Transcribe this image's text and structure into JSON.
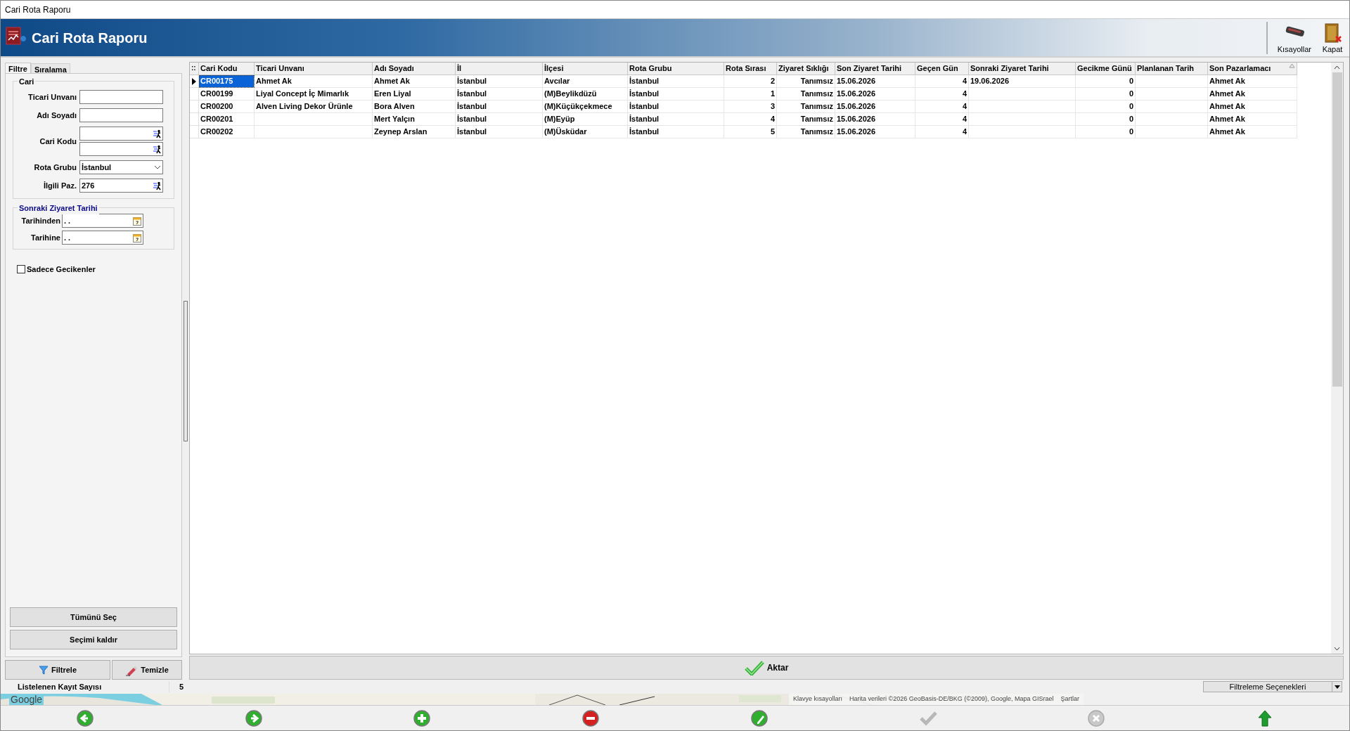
{
  "window": {
    "title": "Cari Rota Raporu"
  },
  "header": {
    "title": "Cari Rota Raporu"
  },
  "toolbar": [
    {
      "label": "Kısayollar",
      "kind": "keyboard"
    },
    {
      "label": "Kapat",
      "kind": "close"
    }
  ],
  "filter_panel": {
    "tabs": [
      {
        "label": "Filtre",
        "selected": true
      },
      {
        "label": "Sıralama",
        "selected": false
      }
    ],
    "cari_group": {
      "title": "Cari",
      "fields": [
        {
          "label": "Ticari Unvanı",
          "kind": "text"
        },
        {
          "label": "Adı Soyadı",
          "kind": "text"
        },
        {
          "label": "Cari Kodu",
          "kind": "lookup_range"
        },
        {
          "label": "Rota Grubu",
          "kind": "combo",
          "value": "İstanbul"
        },
        {
          "label": "İlgili Paz.",
          "kind": "lookup",
          "value": "276"
        }
      ]
    },
    "date_group": {
      "title": "Sonraki Ziyaret Tarihi",
      "fields": [
        {
          "label": "Tarihinden",
          "value": ". ."
        },
        {
          "label": "Tarihine",
          "value": ". ."
        }
      ]
    },
    "checkbox": {
      "label": "Sadece Gecikenler",
      "checked": false
    },
    "select_buttons": [
      "Tümünü Seç",
      "Seçimi kaldır"
    ],
    "action_buttons": [
      {
        "label": "Filtrele",
        "kind": "filter"
      },
      {
        "label": "Temizle",
        "kind": "clear"
      }
    ]
  },
  "grid": {
    "indicator": "::",
    "columns": [
      {
        "title": "Cari Kodu",
        "kind": "text",
        "sorted": false
      },
      {
        "title": "Ticari Unvanı",
        "kind": "text",
        "sorted": false
      },
      {
        "title": "Adı Soyadı",
        "kind": "text",
        "sorted": false
      },
      {
        "title": "İl",
        "kind": "text",
        "sorted": false
      },
      {
        "title": "İlçesi",
        "kind": "text",
        "sorted": false
      },
      {
        "title": "Rota Grubu",
        "kind": "text",
        "sorted": false
      },
      {
        "title": "Rota Sırası",
        "kind": "number",
        "sorted": false
      },
      {
        "title": "Ziyaret Sıklığı",
        "kind": "number",
        "sorted": false
      },
      {
        "title": "Son Ziyaret Tarihi",
        "kind": "text",
        "sorted": false
      },
      {
        "title": "Geçen Gün",
        "kind": "number",
        "sorted": false
      },
      {
        "title": "Sonraki Ziyaret Tarihi",
        "kind": "text",
        "sorted": false
      },
      {
        "title": "Gecikme Günü",
        "kind": "number",
        "sorted": false
      },
      {
        "title": "Planlanan Tarih",
        "kind": "text",
        "sorted": false
      },
      {
        "title": "Son Pazarlamacı",
        "kind": "text",
        "sorted": true
      }
    ],
    "rows": [
      {
        "selected": true,
        "cells": [
          "CR00175",
          "Ahmet Ak",
          "Ahmet  Ak",
          "İstanbul",
          "Avcılar",
          "İstanbul",
          "2",
          "Tanımsız",
          "15.06.2026",
          "4",
          "19.06.2026",
          "0",
          "",
          "Ahmet Ak"
        ]
      },
      {
        "selected": false,
        "cells": [
          "CR00199",
          "Liyal Concept İç Mimarlık",
          "Eren  Liyal",
          "İstanbul",
          "(M)Beylikdüzü",
          "İstanbul",
          "1",
          "Tanımsız",
          "15.06.2026",
          "4",
          "",
          "0",
          "",
          "Ahmet Ak"
        ]
      },
      {
        "selected": false,
        "cells": [
          "CR00200",
          "Alven Living Dekor Ürünle",
          "Bora Alven",
          "İstanbul",
          "(M)Küçükçekmece",
          "İstanbul",
          "3",
          "Tanımsız",
          "15.06.2026",
          "4",
          "",
          "0",
          "",
          "Ahmet Ak"
        ]
      },
      {
        "selected": false,
        "cells": [
          "CR00201",
          "",
          "Mert Yalçın",
          "İstanbul",
          "(M)Eyüp",
          "İstanbul",
          "4",
          "Tanımsız",
          "15.06.2026",
          "4",
          "",
          "0",
          "",
          "Ahmet Ak"
        ]
      },
      {
        "selected": false,
        "cells": [
          "CR00202",
          "",
          "Zeynep Arslan",
          "İstanbul",
          "(M)Üsküdar",
          "İstanbul",
          "5",
          "Tanımsız",
          "15.06.2026",
          "4",
          "",
          "0",
          "",
          "Ahmet Ak"
        ]
      }
    ]
  },
  "export_button": {
    "label": "Aktar"
  },
  "status": {
    "label": "Listelenen Kayıt Sayısı",
    "value": "5"
  },
  "filter_options": {
    "label": "Filtreleme Seçenekleri"
  },
  "map": {
    "kind": "picture",
    "logo": "Google",
    "shortcuts": "Klavye kısayolları",
    "attribution": "Harita verileri ©2026 GeoBasis-DE/BKG (©2009), Google, Mapa GISrael",
    "terms": "Şartlar"
  },
  "nav_buttons": [
    {
      "kind": "back",
      "disabled": false
    },
    {
      "kind": "forward",
      "disabled": false
    },
    {
      "kind": "add",
      "disabled": false
    },
    {
      "kind": "delete",
      "disabled": false
    },
    {
      "kind": "edit",
      "disabled": false
    },
    {
      "kind": "confirm",
      "disabled": true
    },
    {
      "kind": "cancel",
      "disabled": true
    },
    {
      "kind": "up",
      "disabled": false
    }
  ]
}
